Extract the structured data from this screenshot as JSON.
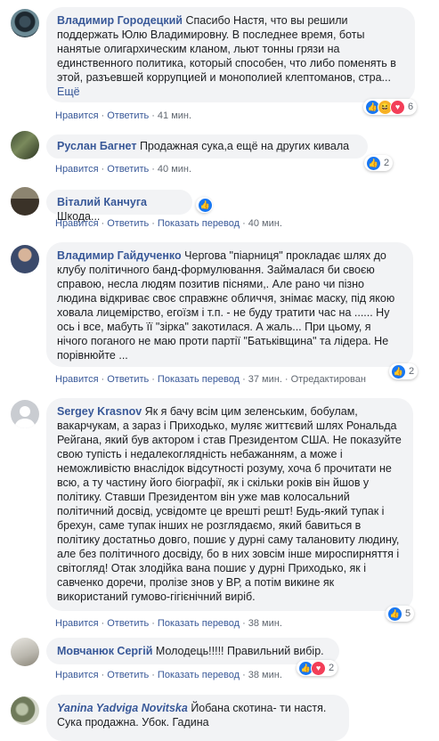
{
  "comments": [
    {
      "author": "Владимир Городецкий",
      "text": "Спасибо Настя, что вы решили поддержать Юлю Владимировну. В последнее время, боты нанятые олигархическим кланом, льют тонны грязи на единственного политика, который способен, что либо поменять в этой, разъевшей коррупцией и монополией клептоманов, стра...",
      "more": "Ещё",
      "actions": [
        "Нравится",
        "Ответить"
      ],
      "time": "41 мин.",
      "reactions": [
        "like",
        "haha",
        "love"
      ],
      "count": "6"
    },
    {
      "author": "Руслан Багнет",
      "text": "Продажная сука,а ещё на других кивала",
      "actions": [
        "Нравится",
        "Ответить"
      ],
      "time": "40 мин.",
      "reactions": [
        "like"
      ],
      "count": "2"
    },
    {
      "author": "Віталий Канчуга",
      "text": "Шкода...",
      "actions": [
        "Нравится",
        "Ответить",
        "Показать перевод"
      ],
      "time": "40 мин.",
      "reactions": [
        "like"
      ],
      "count": ""
    },
    {
      "author": "Владимир Гайдученко",
      "text": "Чергова \"піарниця\" прокладає шлях до клубу політичного банд-формулювання. Займалася би своєю справою, несла людям позитив піснями,. Але рано чи пізно людина відкриває своє справжнє обличчя, знімає маску, під якою ховала лицемірство, егоїзм і т.п. - не буду тратити час на ...... Ну ось і все, мабуть її \"зірка\" закотилася. А жаль... При цьому, я нічого поганого не маю проти партії \"Батьківщина\" та лідера. Не порівнюйте ...",
      "actions": [
        "Нравится",
        "Ответить",
        "Показать перевод"
      ],
      "time": "37 мин.",
      "extra": "Отредактирован",
      "reactions": [
        "like"
      ],
      "count": "2"
    },
    {
      "author": "Sergey Krasnov",
      "text": "Як я бачу всім цим зеленським, бобулам, вакарчукам, а зараз і Приходько, муляє життєвий шлях Рональда Рейгана, який був актором і став Президентом США. Не показуйте свою тупість і недалекоглядність небажанням, а може і неможливістю внаслідок відсутності розуму, хоча б прочитати не всю, а ту частину його біографії, як і скільки років він йшов у політику. Ставши Президентом він уже мав колосальний політичний досвід, усвідомте це врешті решт! Будь-який тупак і брехун, саме тупак інших не розглядаємо, який бавиться в політику достатньо довго, пошиє у дурні саму талановиту людину, але без політичного досвіду, бо в них зовсім інше мироспирняття і світогляд! Отак злодійка вана пошиє у дурні Приходько, як і савченко доречи, пролізе знов у ВР, а потім викине як використаний гумово-гігієнічний виріб.",
      "actions": [
        "Нравится",
        "Ответить",
        "Показать перевод"
      ],
      "time": "38 мин.",
      "reactions": [
        "like"
      ],
      "count": "5"
    },
    {
      "author": "Мовчанюк Сергій",
      "text": "Молодець!!!!! Правильний вибір.",
      "actions": [
        "Нравится",
        "Ответить",
        "Показать перевод"
      ],
      "time": "38 мин.",
      "reactions": [
        "like",
        "love"
      ],
      "count": "2"
    },
    {
      "author": "Yanina Yadviga Novitska",
      "text": "Йобана скотина- ти настя. Сука продажна. Убок. Гадина",
      "reactions": [],
      "count": ""
    }
  ]
}
